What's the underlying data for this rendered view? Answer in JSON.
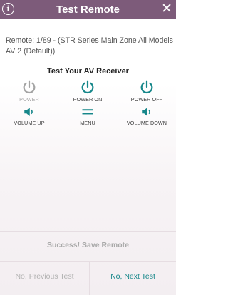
{
  "header": {
    "title": "Test Remote",
    "info_glyph": "i",
    "close_glyph": "✕",
    "background_color": "#7d5b7a"
  },
  "remote_info": "Remote: 1/89  -  (STR Series Main Zone All Models AV 2 (Default))",
  "section_title": "Test Your AV Receiver",
  "colors": {
    "accent": "#16878a",
    "disabled": "#a4a4a4"
  },
  "buttons": [
    {
      "label": "POWER",
      "icon": "power-icon",
      "enabled": false
    },
    {
      "label": "POWER ON",
      "icon": "power-icon",
      "enabled": true
    },
    {
      "label": "POWER OFF",
      "icon": "power-icon",
      "enabled": true
    },
    {
      "label": "VOLUME UP",
      "icon": "volume-icon",
      "enabled": true
    },
    {
      "label": "MENU",
      "icon": "menu-icon",
      "enabled": true
    },
    {
      "label": "VOLUME DOWN",
      "icon": "volume-icon",
      "enabled": true
    }
  ],
  "save_remote": "Success! Save Remote",
  "footer": {
    "previous": "No, Previous Test",
    "next": "No, Next Test"
  }
}
